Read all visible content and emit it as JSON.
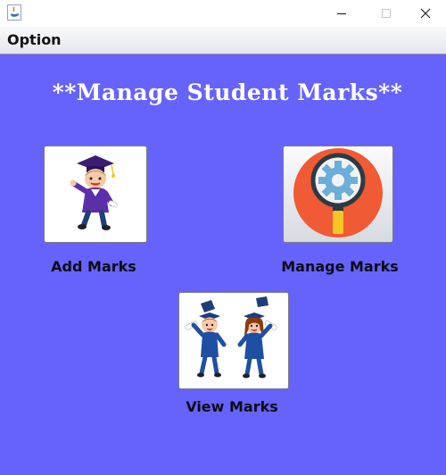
{
  "window": {
    "minimize_glyph": "—",
    "maximize_glyph": "☐",
    "close_glyph": "✕"
  },
  "menubar": {
    "items": [
      {
        "label": "Option"
      }
    ]
  },
  "main": {
    "title": "**Manage Student Marks**",
    "buttons": [
      {
        "label": "Add Marks",
        "image": "graduate-boy-icon"
      },
      {
        "label": "Manage Marks",
        "image": "magnifier-gear-icon"
      },
      {
        "label": "View Marks",
        "image": "graduates-pair-icon"
      }
    ]
  },
  "colors": {
    "background": "#6663fd",
    "title_text": "#ffffff",
    "label_text": "#0c0c14",
    "manage_icon_circle": "#f05a35",
    "gear": "#6baedb",
    "handle": "#f6c626"
  }
}
